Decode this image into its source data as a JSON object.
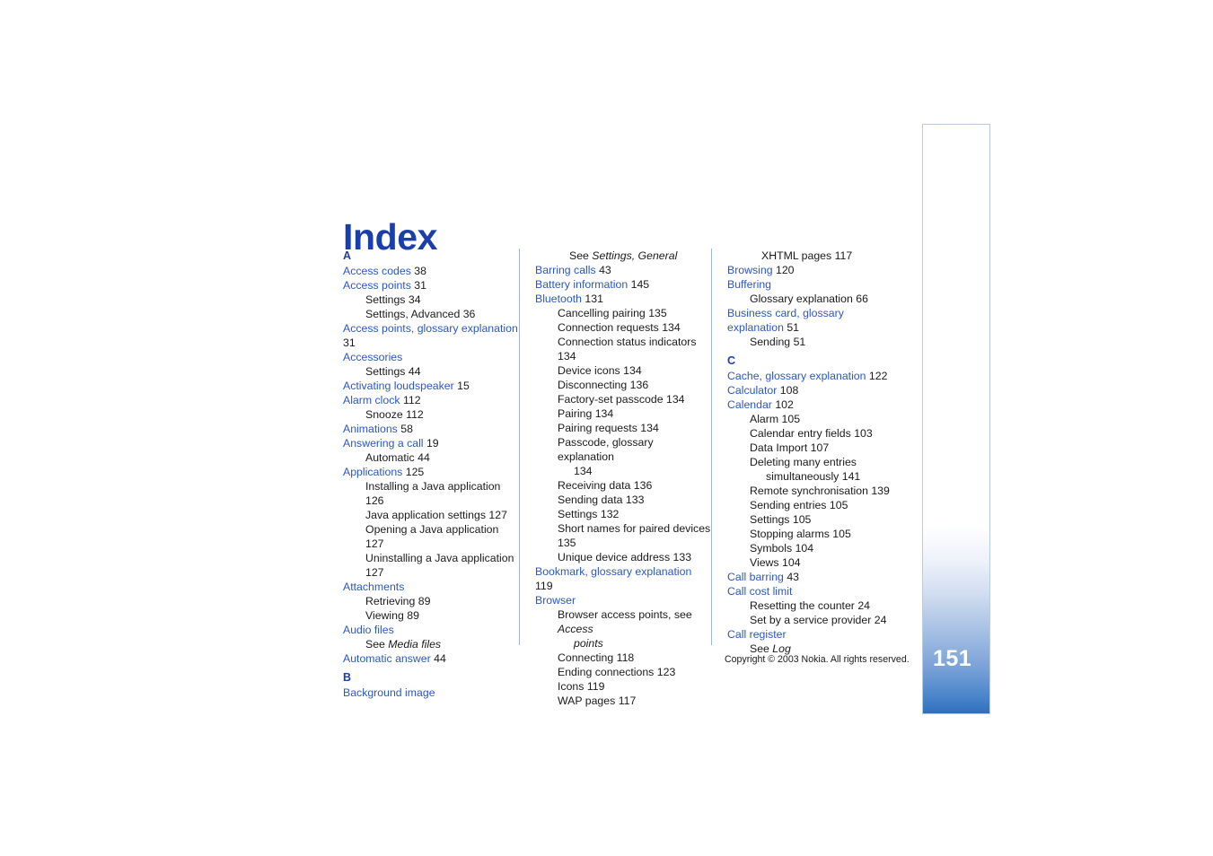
{
  "document": {
    "title": "Index",
    "page_number": "151",
    "copyright": "Copyright © 2003 Nokia. All rights reserved."
  },
  "colors": {
    "heading_blue": "#1a3faa",
    "entry_blue": "#2b57c4",
    "tab_blue": "#2f6fbe",
    "body_black": "#1a1a1a",
    "rule_gray": "#9fb6d6"
  },
  "columns": [
    {
      "id": "column-1",
      "blocks": [
        {
          "type": "letter",
          "text": "A"
        },
        {
          "type": "entry",
          "text": "Access codes",
          "page": "38"
        },
        {
          "type": "entry",
          "text": "Access points",
          "page": "31"
        },
        {
          "type": "sub",
          "text": "Settings",
          "page": "34"
        },
        {
          "type": "sub",
          "text": "Settings, Advanced",
          "page": "36"
        },
        {
          "type": "entry",
          "text": "Access points, glossary explanation",
          "page": "31"
        },
        {
          "type": "entry",
          "text": "Accessories",
          "page": ""
        },
        {
          "type": "sub",
          "text": "Settings",
          "page": "44"
        },
        {
          "type": "entry",
          "text": "Activating loudspeaker",
          "page": "15"
        },
        {
          "type": "entry",
          "text": "Alarm clock",
          "page": "112"
        },
        {
          "type": "sub",
          "text": "Snooze",
          "page": "112"
        },
        {
          "type": "entry",
          "text": "Animations",
          "page": "58"
        },
        {
          "type": "entry",
          "text": "Answering a call",
          "page": "19"
        },
        {
          "type": "sub",
          "text": "Automatic",
          "page": "44"
        },
        {
          "type": "entry",
          "text": "Applications",
          "page": "125"
        },
        {
          "type": "sub",
          "text": "Installing a Java application",
          "page": "126"
        },
        {
          "type": "sub",
          "text": "Java application settings",
          "page": "127"
        },
        {
          "type": "sub",
          "text": "Opening a Java application",
          "page": "127"
        },
        {
          "type": "sub",
          "text": "Uninstalling a Java application",
          "page": "127"
        },
        {
          "type": "entry",
          "text": "Attachments",
          "page": ""
        },
        {
          "type": "sub",
          "text": "Retrieving",
          "page": "89"
        },
        {
          "type": "sub",
          "text": "Viewing",
          "page": "89"
        },
        {
          "type": "entry",
          "text": "Audio files",
          "page": ""
        },
        {
          "type": "sub-see",
          "prefix": "See ",
          "italic": "Media files",
          "page": ""
        },
        {
          "type": "entry",
          "text": "Automatic answer",
          "page": "44"
        },
        {
          "type": "letter",
          "text": "B"
        },
        {
          "type": "entry",
          "text": "Background image",
          "page": ""
        }
      ]
    },
    {
      "id": "column-2",
      "blocks": [
        {
          "type": "sub-see",
          "prefix": "See ",
          "italic": "Settings, General",
          "page": "",
          "indent": "deep"
        },
        {
          "type": "entry",
          "text": "Barring calls",
          "page": "43"
        },
        {
          "type": "entry",
          "text": "Battery information",
          "page": "145"
        },
        {
          "type": "entry",
          "text": "Bluetooth",
          "page": "131"
        },
        {
          "type": "sub",
          "text": "Cancelling pairing",
          "page": "135"
        },
        {
          "type": "sub",
          "text": "Connection requests",
          "page": "134"
        },
        {
          "type": "sub",
          "text": "Connection status indicators",
          "page": "134"
        },
        {
          "type": "sub",
          "text": "Device icons",
          "page": "134"
        },
        {
          "type": "sub",
          "text": "Disconnecting",
          "page": "136"
        },
        {
          "type": "sub",
          "text": "Factory-set passcode",
          "page": "134"
        },
        {
          "type": "sub",
          "text": "Pairing",
          "page": "134"
        },
        {
          "type": "sub",
          "text": "Pairing requests",
          "page": "134"
        },
        {
          "type": "sub-wrap",
          "text": "Passcode, glossary explanation",
          "cont": "134",
          "page": ""
        },
        {
          "type": "sub",
          "text": "Receiving data",
          "page": "136"
        },
        {
          "type": "sub",
          "text": "Sending data",
          "page": "133"
        },
        {
          "type": "sub",
          "text": "Settings",
          "page": "132"
        },
        {
          "type": "sub",
          "text": "Short names for paired devices",
          "page": "135"
        },
        {
          "type": "sub",
          "text": "Unique device address",
          "page": "133"
        },
        {
          "type": "entry",
          "text": "Bookmark, glossary explanation",
          "page": "119"
        },
        {
          "type": "entry",
          "text": "Browser",
          "page": ""
        },
        {
          "type": "sub-wrap-ital",
          "text": "Browser access points, see ",
          "italic": "Access",
          "cont": "points",
          "page": ""
        },
        {
          "type": "sub",
          "text": "Connecting",
          "page": "118"
        },
        {
          "type": "sub",
          "text": "Ending connections",
          "page": "123"
        },
        {
          "type": "sub",
          "text": "Icons",
          "page": "119"
        },
        {
          "type": "sub",
          "text": "WAP pages",
          "page": "117"
        }
      ]
    },
    {
      "id": "column-3",
      "blocks": [
        {
          "type": "sub",
          "text": "XHTML pages",
          "page": "117",
          "indent": "deep"
        },
        {
          "type": "entry",
          "text": "Browsing",
          "page": "120"
        },
        {
          "type": "entry",
          "text": "Buffering",
          "page": ""
        },
        {
          "type": "sub",
          "text": "Glossary explanation",
          "page": "66"
        },
        {
          "type": "entry",
          "text": "Business card, glossary explanation",
          "page": "51"
        },
        {
          "type": "sub",
          "text": "Sending",
          "page": "51"
        },
        {
          "type": "letter",
          "text": "C"
        },
        {
          "type": "entry",
          "text": "Cache, glossary explanation",
          "page": "122"
        },
        {
          "type": "entry",
          "text": "Calculator",
          "page": "108"
        },
        {
          "type": "entry",
          "text": "Calendar",
          "page": "102"
        },
        {
          "type": "sub",
          "text": "Alarm",
          "page": "105"
        },
        {
          "type": "sub",
          "text": "Calendar entry fields",
          "page": "103"
        },
        {
          "type": "sub",
          "text": "Data Import",
          "page": "107"
        },
        {
          "type": "sub-wrap",
          "text": "Deleting many entries",
          "cont": "simultaneously 141",
          "page": ""
        },
        {
          "type": "sub",
          "text": "Remote synchronisation",
          "page": "139"
        },
        {
          "type": "sub",
          "text": "Sending entries",
          "page": "105"
        },
        {
          "type": "sub",
          "text": "Settings",
          "page": "105"
        },
        {
          "type": "sub",
          "text": "Stopping alarms",
          "page": "105"
        },
        {
          "type": "sub",
          "text": "Symbols",
          "page": "104"
        },
        {
          "type": "sub",
          "text": "Views",
          "page": "104"
        },
        {
          "type": "entry",
          "text": "Call barring",
          "page": "43"
        },
        {
          "type": "entry",
          "text": "Call cost limit",
          "page": ""
        },
        {
          "type": "sub",
          "text": "Resetting the counter",
          "page": "24"
        },
        {
          "type": "sub",
          "text": "Set by a service provider",
          "page": "24"
        },
        {
          "type": "entry",
          "text": "Call register",
          "page": ""
        },
        {
          "type": "sub-see",
          "prefix": "See ",
          "italic": "Log",
          "page": ""
        }
      ]
    }
  ]
}
